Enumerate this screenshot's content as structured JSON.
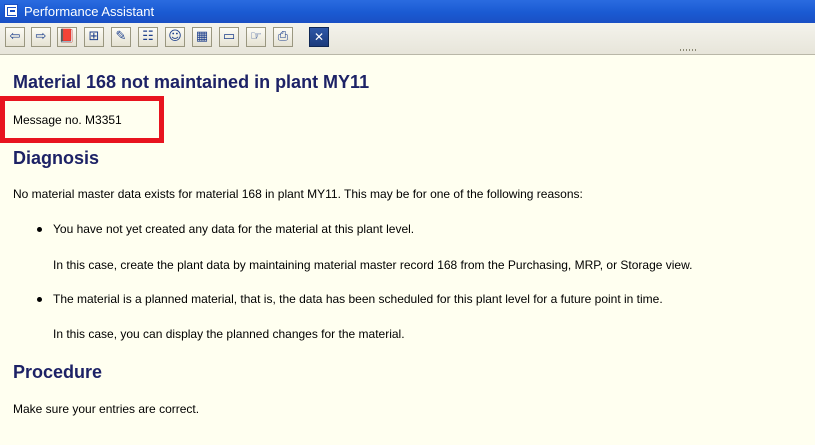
{
  "window": {
    "title": "Performance Assistant"
  },
  "toolbar": {
    "buttons": [
      {
        "name": "back-button",
        "icon": "arrow-left-icon",
        "glyph": "⇦"
      },
      {
        "name": "forward-button",
        "icon": "arrow-right-icon",
        "glyph": "⇨"
      },
      {
        "name": "book-button",
        "icon": "book-icon",
        "glyph": "📕"
      },
      {
        "name": "structure-button",
        "icon": "hierarchy-icon",
        "glyph": "⊞"
      },
      {
        "name": "edit-button",
        "icon": "pencil-icon",
        "glyph": "✎"
      },
      {
        "name": "technical-info-button",
        "icon": "info-icon",
        "glyph": "☷"
      },
      {
        "name": "users-button",
        "icon": "users-icon",
        "glyph": "☺"
      },
      {
        "name": "table-button",
        "icon": "table-icon",
        "glyph": "▦"
      },
      {
        "name": "field-button",
        "icon": "field-icon",
        "glyph": "▭"
      },
      {
        "name": "hand-button",
        "icon": "hand-icon",
        "glyph": "☞"
      },
      {
        "name": "print-button",
        "icon": "printer-icon",
        "glyph": "⎙"
      },
      {
        "name": "close-button",
        "icon": "close-icon",
        "glyph": "✕"
      }
    ]
  },
  "content": {
    "title": "Material 168 not maintained in plant MY11",
    "message_no": "Message no. M3351",
    "diagnosis": {
      "heading": "Diagnosis",
      "intro": "No material master data exists for material 168 in plant MY11. This may be for one of the following reasons:",
      "bullets": [
        {
          "text": "You have not yet created any data for the material at this plant level.",
          "detail": "In this case, create the plant data by maintaining material master record 168 from the Purchasing, MRP, or Storage view."
        },
        {
          "text": "The material is a planned material, that is, the data has been scheduled for this plant level for a future point in time.",
          "detail": "In this case, you can display the planned changes for the material."
        }
      ]
    },
    "procedure": {
      "heading": "Procedure",
      "text": "Make sure your entries are correct."
    }
  },
  "colors": {
    "highlight_box": "#e8141f",
    "heading": "#1d2266",
    "background": "#fffff0",
    "titlebar": "#1a5ad2"
  }
}
